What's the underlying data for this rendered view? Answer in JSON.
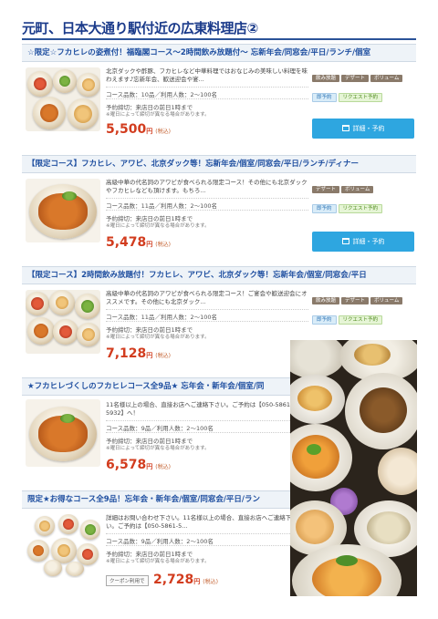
{
  "page_title": "元町、日本大通り駅付近の広東料理店②",
  "courses": [
    {
      "title": "☆限定☆フカヒレの姿煮付！福臨閣コース～2時間飲み放題付～ 忘新年会/同窓会/平日/ランチ/個室",
      "desc": "北京ダックや酢豚、フカヒレなど中華料理ではおなじみの美味しい料理を味わえます♪忘新年会、歓送迎会や宴...",
      "count": "コース品数：10品／利用人数：2～100名",
      "reserve": "予約締切：来店日の前日1時まで",
      "note": "※曜日によって締切が異なる場合があります。",
      "price": "5,500",
      "yen": "円",
      "tax": "(税込)",
      "tags": [
        {
          "label": "飲み放題",
          "style": "gray"
        },
        {
          "label": "デザート",
          "style": "gray"
        },
        {
          "label": "ボリューム",
          "style": "gray"
        },
        {
          "label": "即予約",
          "style": "blue"
        },
        {
          "label": "リクエスト予約",
          "style": "green"
        }
      ],
      "button": "詳細・予約"
    },
    {
      "title": "【限定コース】フカヒレ、アワビ、北京ダック等！忘新年会/個室/同窓会/平日/ランチ/ディナー",
      "desc": "高級中華の代名詞のアワビが食べられる限定コース！その他にも北京ダックやフカヒレなども頂けます。もちろ...",
      "count": "コース品数：11品／利用人数：2～100名",
      "reserve": "予約締切：来店日の前日1時まで",
      "note": "※曜日によって締切が異なる場合があります。",
      "price": "5,478",
      "yen": "円",
      "tax": "(税込)",
      "tags": [
        {
          "label": "デザート",
          "style": "gray"
        },
        {
          "label": "ボリューム",
          "style": "gray"
        },
        {
          "label": "即予約",
          "style": "blue"
        },
        {
          "label": "リクエスト予約",
          "style": "green"
        }
      ],
      "button": "詳細・予約"
    },
    {
      "title": "【限定コース】2時間飲み放題付！フカヒレ、アワビ、北京ダック等！忘新年会/個室/同窓会/平日",
      "desc": "高級中華の代名詞のアワビが食べられる限定コース！ご宴会や歓送迎会にオススメです。その他にも北京ダック...",
      "count": "コース品数：11品／利用人数：2～100名",
      "reserve": "予約締切：来店日の前日1時まで",
      "note": "※曜日によって締切が異なる場合があります。",
      "price": "7,128",
      "yen": "円",
      "tax": "(税込)",
      "tags": [
        {
          "label": "飲み放題",
          "style": "gray"
        },
        {
          "label": "デザート",
          "style": "gray"
        },
        {
          "label": "ボリューム",
          "style": "gray"
        },
        {
          "label": "即予約",
          "style": "blue"
        },
        {
          "label": "リクエスト予約",
          "style": "green"
        }
      ]
    },
    {
      "title": "★フカヒレづくしのフカヒレコース全9品★ 忘年会・新年会/個室/同",
      "desc": "11名様以上の場合、直接お店へご連絡下さい。ご予約は【050-5861-5932】へ！",
      "count": "コース品数：9品／利用人数：2～100名",
      "reserve": "予約締切：来店日の前日1時まで",
      "note": "※曜日によって締切が異なる場合があります。",
      "price": "6,578",
      "yen": "円",
      "tax": "(税込)"
    },
    {
      "title": "限定★お得なコース全9品！忘年会・新年会/個室/同窓会/平日/ラン",
      "desc": "詳細はお問い合わせ下さい。11名様以上の場合、直接お店へご連絡下さい。ご予約は【050-5861-5...",
      "count": "コース品数：9品／利用人数：2～100名",
      "reserve": "予約締切：来店日の前日1時まで",
      "note": "※曜日によって締切が異なる場合があります。",
      "coupon": "クーポン利用で",
      "price": "2,728",
      "yen": "円",
      "tax": "(税込)"
    }
  ],
  "colors": {
    "accent": "#2ea6e0",
    "price": "#d23c1e",
    "title": "#1a3a8a"
  }
}
